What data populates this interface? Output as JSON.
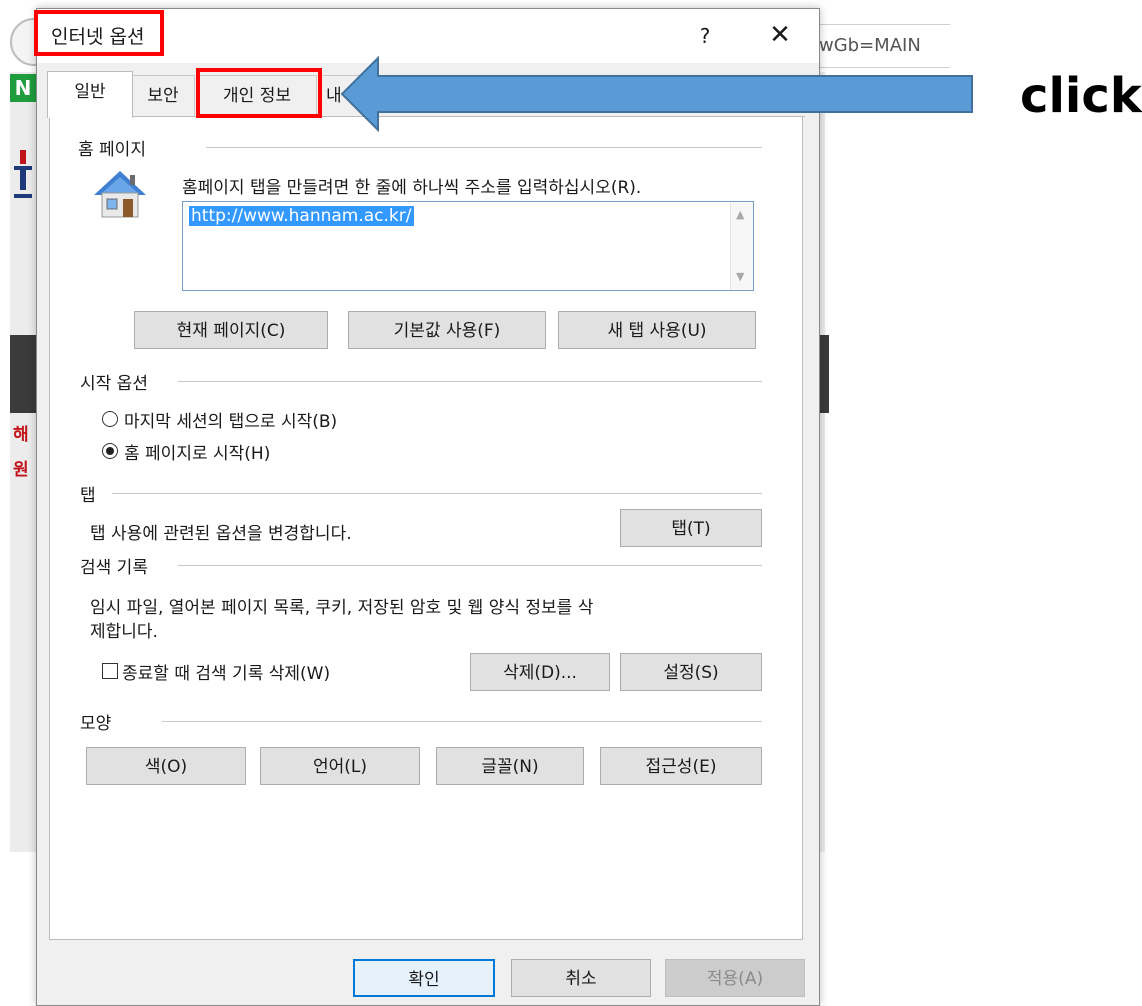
{
  "background": {
    "address_text": "wGb=MAIN",
    "green_badge": "N",
    "side_text_1": "해",
    "side_text_2": "원"
  },
  "dialog": {
    "title": "인터넷 옵션",
    "help_glyph": "?",
    "close_glyph": "✕",
    "tabs": [
      {
        "label": "일반",
        "active": true
      },
      {
        "label": "보안"
      },
      {
        "label": "개인 정보"
      },
      {
        "label": "내"
      }
    ],
    "home": {
      "section_title": "홈 페이지",
      "instructions": "홈페이지 탭을 만들려면 한 줄에 하나씩 주소를 입력하십시오(R).",
      "url": "http://www.hannam.ac.kr/",
      "buttons": {
        "current": "현재 페이지(C)",
        "default": "기본값 사용(F)",
        "new_tab": "새 탭 사용(U)"
      }
    },
    "startup": {
      "section_title": "시작 옵션",
      "option_last_session": "마지막 세션의 탭으로 시작(B)",
      "option_homepage": "홈 페이지로 시작(H)"
    },
    "tabs_section": {
      "section_title": "탭",
      "description": "탭 사용에 관련된 옵션을 변경합니다.",
      "button": "탭(T)"
    },
    "history": {
      "section_title": "검색 기록",
      "description_line1": "임시 파일, 열어본 페이지 목록, 쿠키, 저장된 암호 및 웹 양식 정보를 삭",
      "description_line2": "제합니다.",
      "checkbox_label": "종료할 때 검색 기록 삭제(W)",
      "delete_button": "삭제(D)...",
      "settings_button": "설정(S)"
    },
    "appearance": {
      "section_title": "모양",
      "buttons": {
        "colors": "색(O)",
        "languages": "언어(L)",
        "fonts": "글꼴(N)",
        "accessibility": "접근성(E)"
      }
    },
    "footer": {
      "ok": "확인",
      "cancel": "취소",
      "apply": "적용(A)"
    }
  },
  "annotation": {
    "click_label": "click",
    "highlight_color": "#ff0000",
    "arrow_color": "#5b9bd5"
  }
}
